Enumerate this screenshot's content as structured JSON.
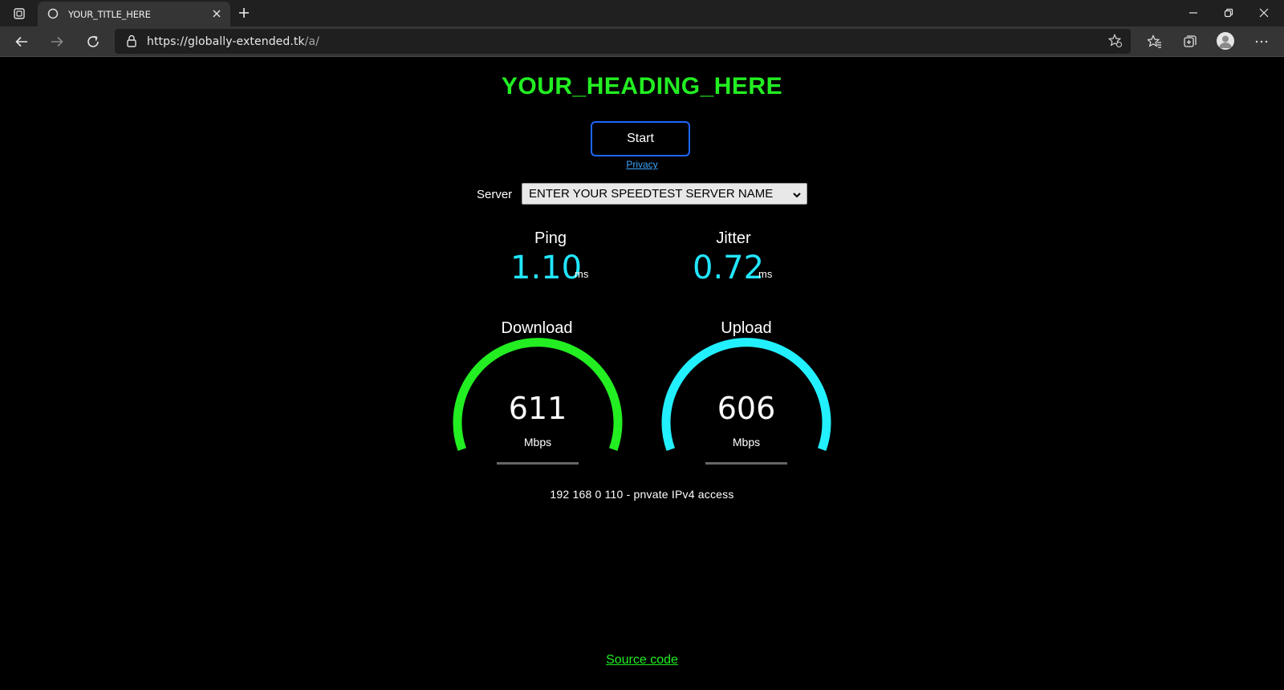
{
  "browser": {
    "tab_title": "YOUR_TITLE_HERE",
    "url_host": "https://globally-extended.tk",
    "url_path": "/a/"
  },
  "page": {
    "heading": "YOUR_HEADING_HERE",
    "start_label": "Start",
    "privacy_label": "Privacy",
    "server_label": "Server",
    "server_selected": "ENTER YOUR SPEEDTEST SERVER NAME",
    "ping": {
      "label": "Ping",
      "value": "1.10",
      "unit": "ms"
    },
    "jitter": {
      "label": "Jitter",
      "value": "0.72",
      "unit": "ms"
    },
    "download": {
      "label": "Download",
      "value": "611",
      "unit": "Mbps",
      "color": "#22ee22"
    },
    "upload": {
      "label": "Upload",
      "value": "606",
      "unit": "Mbps",
      "color": "#22f0ff"
    },
    "ip_info": "192 168 0 110 - pnvate IPv4 access",
    "source_label": "Source code"
  },
  "colors": {
    "heading": "#22ee22",
    "metric_value": "#22e6ff",
    "button_border": "#1e66ff",
    "link": "#3da7ff"
  }
}
